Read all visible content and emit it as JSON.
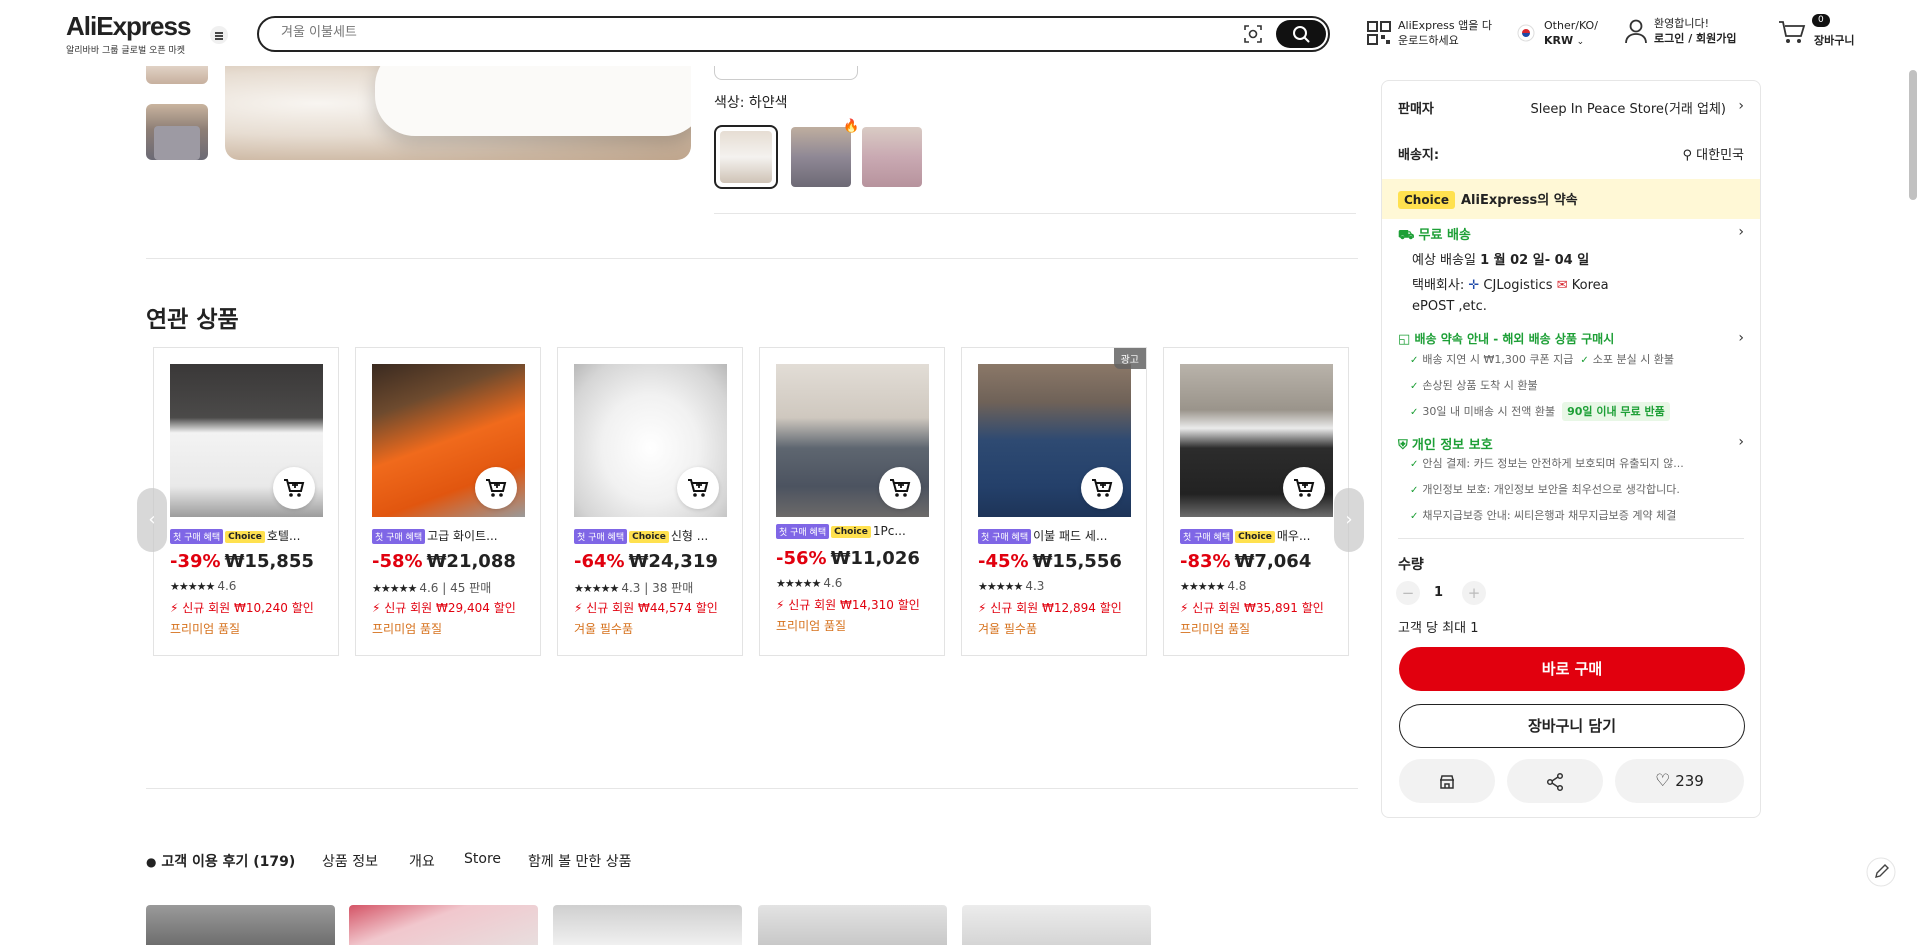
{
  "header": {
    "logo": "AliExpress",
    "logo_sub": "알리바바 그룹 글로벌 오픈 마켓",
    "search_placeholder": "겨울 이불세트",
    "app_line1": "AliExpress 앱을 다",
    "app_line2": "운로드하세요",
    "lang_line1": "Other/KO/",
    "lang_line2": "KRW",
    "user_line1": "환영합니다!",
    "user_line2": "로그인 / 회원가입",
    "cart_count": "0",
    "cart_label": "장바구니"
  },
  "product": {
    "color_label": "색상: 하얀색"
  },
  "related": {
    "title": "연관 상품",
    "first_tag": "첫 구매 혜택",
    "choice_tag": "Choice",
    "items": [
      {
        "title": "호텔...",
        "choice": true,
        "pct": "-39%",
        "price": "₩15,855",
        "rating": "4.6",
        "sold": "",
        "coupon": "신규 회원 ₩10,240 할인",
        "tagline": "프리미엄 품질",
        "ad": ""
      },
      {
        "title": "고급 화이트...",
        "choice": false,
        "pct": "-58%",
        "price": "₩21,088",
        "rating": "4.6",
        "sold": "45 판매",
        "coupon": "신규 회원 ₩29,404 할인",
        "tagline": "프리미엄 품질",
        "ad": ""
      },
      {
        "title": "신형 ...",
        "choice": true,
        "pct": "-64%",
        "price": "₩24,319",
        "rating": "4.3",
        "sold": "38 판매",
        "coupon": "신규 회원 ₩44,574 할인",
        "tagline": "겨울 필수품",
        "ad": ""
      },
      {
        "title": "1Pc...",
        "choice": true,
        "pct": "-56%",
        "price": "₩11,026",
        "rating": "4.6",
        "sold": "",
        "coupon": "신규 회원 ₩14,310 할인",
        "tagline": "프리미엄 품질",
        "ad": ""
      },
      {
        "title": "이불 패드 세...",
        "choice": false,
        "pct": "-45%",
        "price": "₩15,556",
        "rating": "4.3",
        "sold": "",
        "coupon": "신규 회원 ₩12,894 할인",
        "tagline": "겨울 필수품",
        "ad": "광고"
      },
      {
        "title": "매우...",
        "choice": true,
        "pct": "-83%",
        "price": "₩7,064",
        "rating": "4.8",
        "sold": "",
        "coupon": "신규 회원 ₩35,891 할인",
        "tagline": "프리미엄 품질",
        "ad": ""
      }
    ]
  },
  "tabs": [
    "고객 이용 후기 (179)",
    "상품 정보",
    "개요",
    "Store",
    "함께 볼 만한 상품"
  ],
  "sidebar": {
    "seller_label": "판매자",
    "seller_name": "Sleep In Peace Store(거래 업체)",
    "ship_label": "배송지:",
    "ship_country": "대한민국",
    "choice_badge": "Choice",
    "choice_promise": "AliExpress의 약속",
    "free_shipping": "무료 배송",
    "eta_prefix": "예상 배송일",
    "eta_date": "1 월 02 일- 04 일",
    "courier_prefix": "택배회사:",
    "courier_1": "CJLogistics",
    "courier_2": "Korea",
    "courier_3": "ePOST ,etc.",
    "promise_title": "배송 약속 안내 - 해외 배송 상품 구매시",
    "promise_items": [
      "배송 지연 시 ₩1,300 쿠폰 지급",
      "소포 분실 시 환불",
      "손상된 상품 도착 시 환불",
      "30일 내 미배송 시 전액 환불"
    ],
    "return_tag": "90일 이내 무료 반품",
    "privacy_title": "개인 정보 보호",
    "privacy_items": [
      "안심 결제: 카드 정보는 안전하게 보호되며 유출되지 않...",
      "개인정보 보호: 개인정보 보안을 최우선으로 생각합니다.",
      "채무지급보증 안내: 씨티은행과 채무지급보증 계약 체결"
    ],
    "qty_label": "수량",
    "qty_value": "1",
    "qty_limit": "고객 당 최대 1",
    "buy_now": "바로 구매",
    "add_cart": "장바구니 담기",
    "wish_count": "239"
  },
  "colors": {
    "accent": "#e1000e",
    "green": "#1d9f36",
    "choice": "#ffe14f",
    "first_tag": "#7f66e6"
  }
}
